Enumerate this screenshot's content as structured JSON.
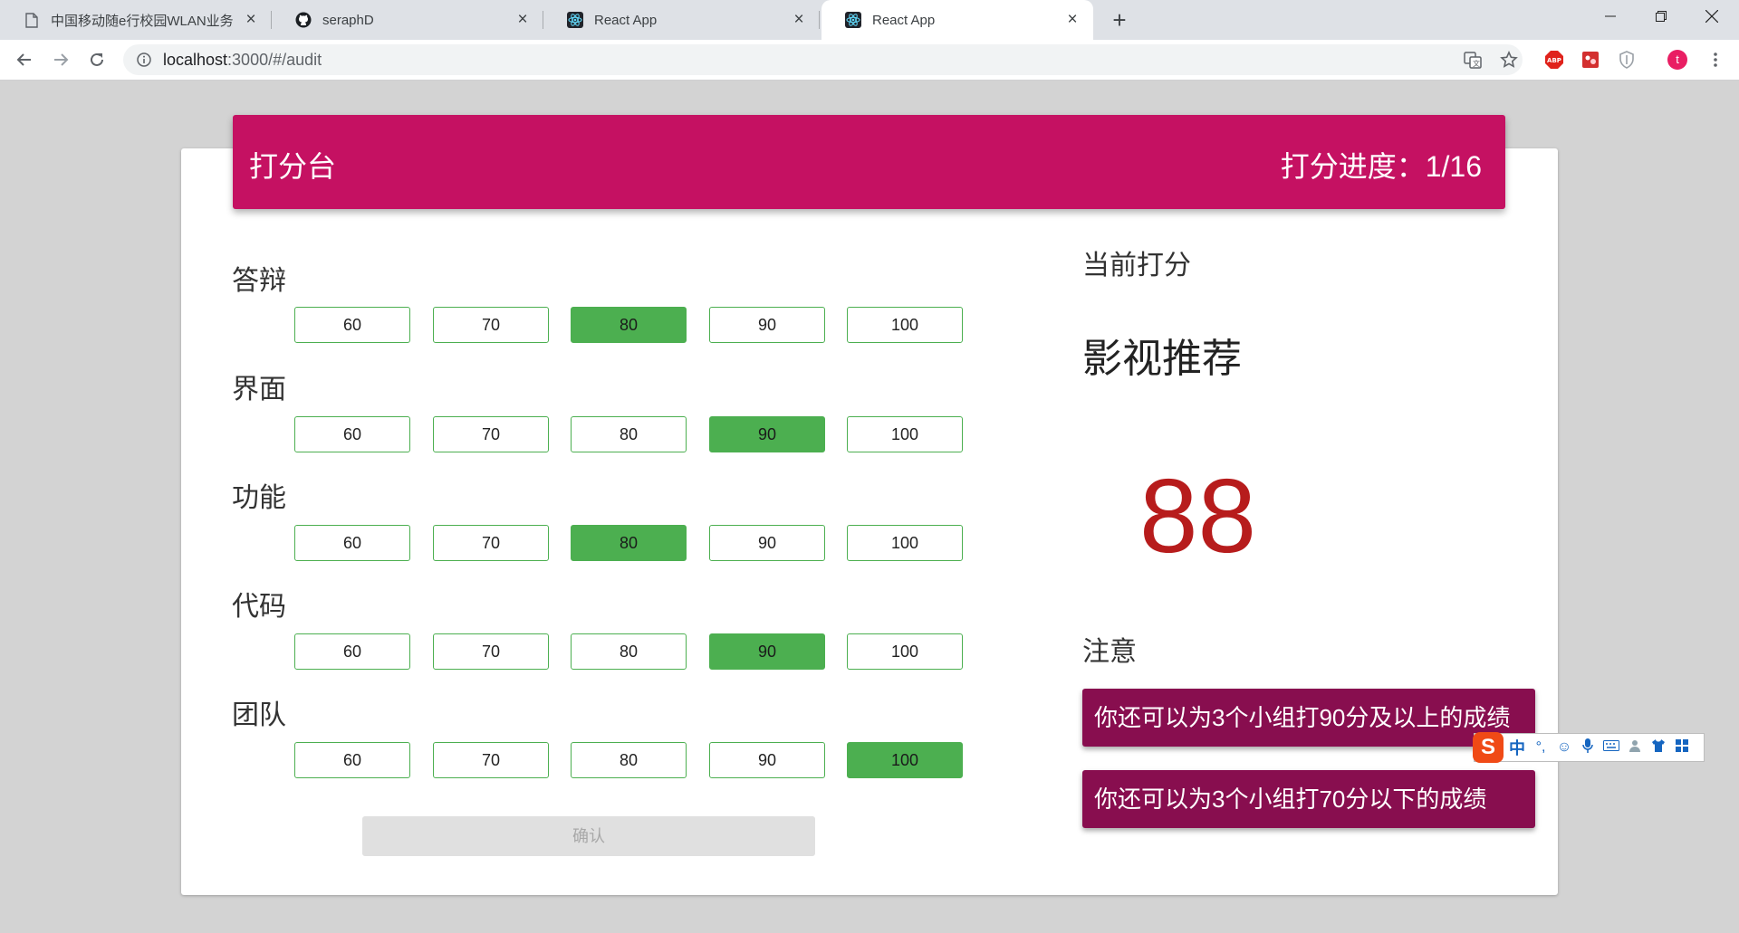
{
  "browser": {
    "tabs": [
      {
        "title": "中国移动随e行校园WLAN业务",
        "favicon": "page-icon",
        "active": false
      },
      {
        "title": "seraphD",
        "favicon": "github-icon",
        "active": false
      },
      {
        "title": "React App",
        "favicon": "react-icon",
        "active": false
      },
      {
        "title": "React App",
        "favicon": "react-icon",
        "active": true
      }
    ],
    "url_host": "localhost",
    "url_rest": ":3000/#/audit",
    "profile_initial": "t"
  },
  "header": {
    "title": "打分台",
    "progress": "打分进度：1/16",
    "color": "#c51162"
  },
  "criteria": [
    {
      "label": "答辩",
      "options": [
        "60",
        "70",
        "80",
        "90",
        "100"
      ],
      "selected": "80"
    },
    {
      "label": "界面",
      "options": [
        "60",
        "70",
        "80",
        "90",
        "100"
      ],
      "selected": "90"
    },
    {
      "label": "功能",
      "options": [
        "60",
        "70",
        "80",
        "90",
        "100"
      ],
      "selected": "80"
    },
    {
      "label": "代码",
      "options": [
        "60",
        "70",
        "80",
        "90",
        "100"
      ],
      "selected": "90"
    },
    {
      "label": "团队",
      "options": [
        "60",
        "70",
        "80",
        "90",
        "100"
      ],
      "selected": "100"
    }
  ],
  "confirm_label": "确认",
  "current": {
    "heading": "当前打分",
    "project": "影视推荐",
    "score": "88"
  },
  "notice": {
    "heading": "注意",
    "items": [
      "你还可以为3个小组打90分及以上的成绩",
      "你还可以为3个小组打70分以下的成绩"
    ]
  },
  "ime": {
    "mode": "中",
    "punct": "°,"
  },
  "colors": {
    "selected": "#4caf50",
    "notice": "#880e4f",
    "score": "#b71c1c"
  }
}
